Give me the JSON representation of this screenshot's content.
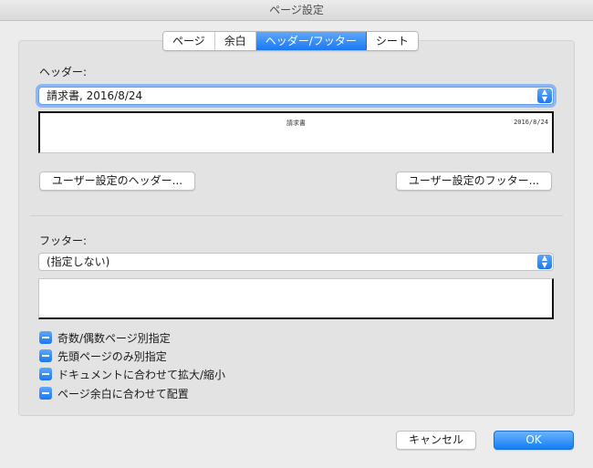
{
  "window": {
    "title": "ページ設定"
  },
  "tabs": [
    {
      "label": "ページ",
      "active": false
    },
    {
      "label": "余白",
      "active": false
    },
    {
      "label": "ヘッダー/フッター",
      "active": true
    },
    {
      "label": "シート",
      "active": false
    }
  ],
  "header": {
    "label": "ヘッダー:",
    "selected": "請求書, 2016/8/24",
    "preview": {
      "center": "請求書",
      "right": "2016/8/24"
    },
    "custom_button": "ユーザー設定のヘッダー..."
  },
  "footer": {
    "label": "フッター:",
    "selected": "(指定しない)",
    "custom_button": "ユーザー設定のフッター..."
  },
  "options": [
    {
      "label": "奇数/偶数ページ別指定",
      "state": "mixed"
    },
    {
      "label": "先頭ページのみ別指定",
      "state": "mixed"
    },
    {
      "label": "ドキュメントに合わせて拡大/縮小",
      "state": "mixed"
    },
    {
      "label": "ページ余白に合わせて配置",
      "state": "mixed"
    }
  ],
  "actions": {
    "cancel": "キャンセル",
    "ok": "OK"
  },
  "colors": {
    "accent": "#1979f2",
    "window_bg": "#ececec",
    "panel_bg": "#e3e3e3"
  }
}
